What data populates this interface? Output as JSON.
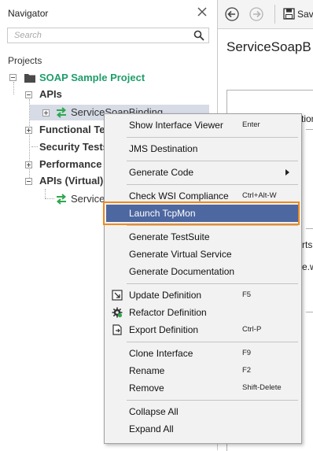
{
  "navigator": {
    "title": "Navigator",
    "search_placeholder": "Search",
    "projects_label": "Projects",
    "tree": {
      "project": "SOAP Sample Project",
      "apis": "APIs",
      "binding": "ServiceSoapBinding",
      "functional_tests": "Functional Tests",
      "security_tests": "Security Tests",
      "performance_tests": "Performance T",
      "apis_virtual": "APIs (Virtual)",
      "virtual_service": "ServiceS"
    }
  },
  "toolbar": {
    "back_icon": "back-arrow-icon",
    "forward_icon": "forward-arrow-icon",
    "save_label": "Sav"
  },
  "editor": {
    "title": "ServiceSoapB",
    "fragments": [
      "tion",
      "rts",
      "e.w"
    ]
  },
  "context_menu": {
    "items": [
      {
        "label": "Show Interface Viewer",
        "shortcut": "Enter"
      },
      {
        "label": "JMS Destination"
      },
      {
        "label": "Generate Code",
        "submenu": true
      },
      {
        "label": "Check WSI Compliance",
        "shortcut": "Ctrl+Alt-W"
      },
      {
        "label": "Launch TcpMon",
        "highlighted": true
      },
      {
        "label": "Generate TestSuite"
      },
      {
        "label": "Generate Virtual Service"
      },
      {
        "label": "Generate Documentation"
      },
      {
        "label": "Update Definition",
        "shortcut": "F5",
        "icon": "update-definition-icon"
      },
      {
        "label": "Refactor Definition",
        "icon": "refactor-gear-icon"
      },
      {
        "label": "Export Definition",
        "shortcut": "Ctrl-P",
        "icon": "export-definition-icon"
      },
      {
        "label": "Clone Interface",
        "shortcut": "F9"
      },
      {
        "label": "Rename",
        "shortcut": "F2"
      },
      {
        "label": "Remove",
        "shortcut": "Shift-Delete"
      },
      {
        "label": "Collapse All"
      },
      {
        "label": "Expand All"
      }
    ]
  },
  "colors": {
    "project_green": "#1f9d6b",
    "menu_highlight": "#4d67a0",
    "callout_orange": "#f08a1c",
    "selection_bg": "#d6dbe6"
  }
}
